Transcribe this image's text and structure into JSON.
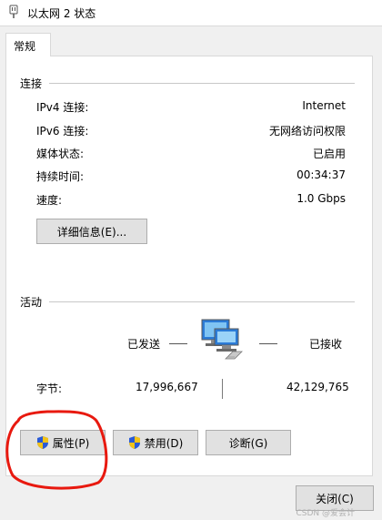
{
  "window": {
    "title": "以太网 2 状态"
  },
  "tabs": [
    {
      "label": "常规"
    }
  ],
  "connection": {
    "header": "连接",
    "rows": [
      {
        "label": "IPv4 连接:",
        "value": "Internet"
      },
      {
        "label": "IPv6 连接:",
        "value": "无网络访问权限"
      },
      {
        "label": "媒体状态:",
        "value": "已启用"
      },
      {
        "label": "持续时间:",
        "value": "00:34:37"
      },
      {
        "label": "速度:",
        "value": "1.0 Gbps"
      }
    ],
    "details_button": "详细信息(E)..."
  },
  "activity": {
    "header": "活动",
    "sent_label": "已发送",
    "received_label": "已接收",
    "bytes_label": "字节:",
    "bytes_sent": "17,996,667",
    "bytes_received": "42,129,765"
  },
  "buttons": {
    "properties": "属性(P)",
    "disable": "禁用(D)",
    "diagnose": "诊断(G)",
    "close": "关闭(C)"
  },
  "watermark": "CSDN @爱会计",
  "colors": {
    "annotation_circle": "#e8190f",
    "shield_blue": "#2a5bd7",
    "shield_yellow": "#f2c318"
  },
  "icons": {
    "title": "network-adapter-icon",
    "activity": "network-computers-icon",
    "shield": "uac-shield-icon"
  }
}
